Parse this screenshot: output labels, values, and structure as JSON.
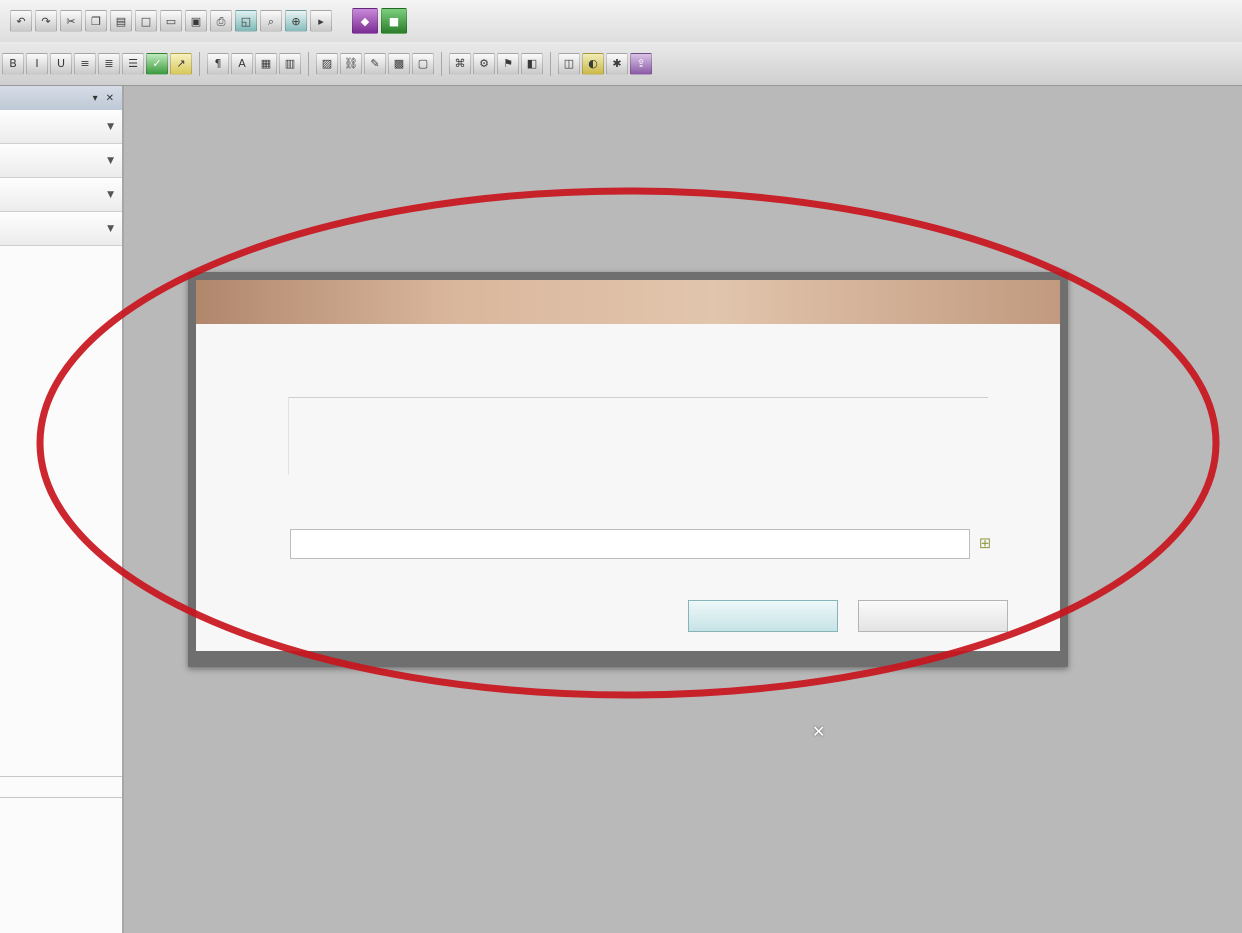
{
  "toolbar_top": {
    "icons": [
      "undo-icon",
      "redo-icon",
      "cut-icon",
      "copy-icon",
      "paste-icon",
      "new-icon",
      "open-icon",
      "save-icon",
      "print-icon",
      "preview-icon",
      "find-icon",
      "zoom-icon",
      "run-icon",
      "purple-app-icon",
      "green-app-icon"
    ]
  },
  "toolbar_second": {
    "icons": [
      "bold-icon",
      "italic-icon",
      "underline-icon",
      "align-left-icon",
      "align-center-icon",
      "align-right-icon",
      "green-check-icon",
      "yellow-arrow-icon",
      "format-icon",
      "font-icon",
      "table-icon",
      "chart-icon",
      "image-icon",
      "link-icon",
      "comment-icon",
      "grid-icon",
      "field-icon",
      "script-icon",
      "macro-icon",
      "debug-icon",
      "view-icon",
      "layout-icon",
      "color-icon",
      "settings-icon",
      "export-icon"
    ]
  },
  "side_panel": {
    "rows": [
      {
        "label": ""
      },
      {
        "label": ""
      },
      {
        "label": ""
      },
      {
        "label": ""
      }
    ]
  },
  "dialog": {
    "title": "",
    "prompt_label": "",
    "readonly_text": "",
    "input_label": "",
    "input_value": "",
    "ok_label": "",
    "cancel_label": ""
  },
  "caption": {
    "line1": "",
    "line2": ""
  },
  "colors": {
    "highlight_ring": "#c8141c",
    "caption_text": "#d9d35a",
    "dialog_title_gradient": "#d9b79d",
    "ok_button": "#c6e3e6",
    "workspace": "#b9b9b9"
  }
}
